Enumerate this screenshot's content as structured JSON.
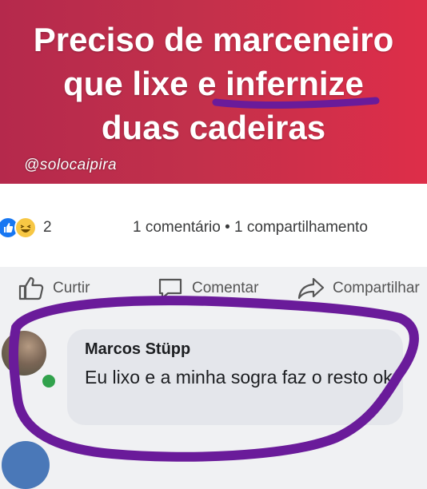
{
  "post": {
    "line1": "Preciso de marceneiro",
    "line2": "que lixe e infernize",
    "line3": "duas cadeiras",
    "watermark": "@solocaipira",
    "bg_color_left": "#b5294c",
    "bg_color_right": "#de2e49"
  },
  "stats": {
    "reactions": [
      "like-icon",
      "haha-icon"
    ],
    "reaction_count": "2",
    "engagement": "1 comentário • 1 compartilhamento"
  },
  "actions": {
    "like_label": "Curtir",
    "comment_label": "Comentar",
    "share_label": "Compartilhar"
  },
  "comment": {
    "author": "Marcos Stüpp",
    "text": "Eu lixo e a minha sogra faz o resto ok",
    "online": true
  },
  "annotation_color": "#6a1b9a",
  "accent_color": "#1877f2"
}
